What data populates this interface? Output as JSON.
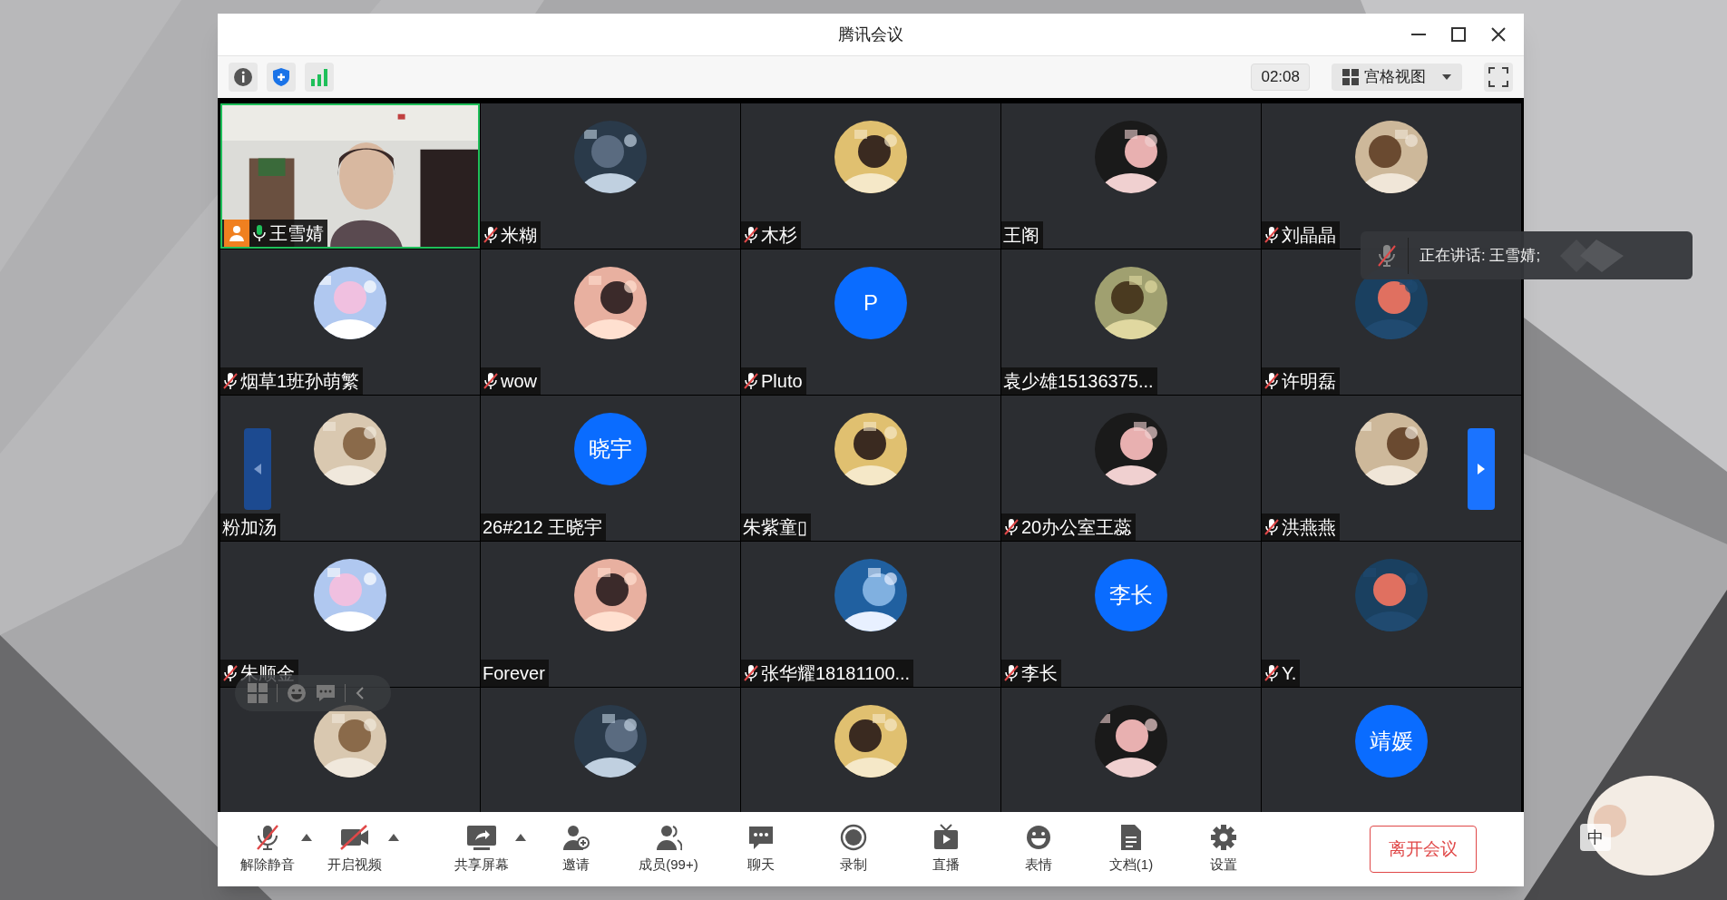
{
  "window": {
    "title": "腾讯会议"
  },
  "info_bar": {
    "timer": "02:08",
    "view_label": "宫格视图"
  },
  "tiles": [
    {
      "name": "王雪婧",
      "host": true,
      "muted": false,
      "talking": true,
      "avatar": {
        "kind": "video"
      }
    },
    {
      "name": "米糊",
      "muted": true,
      "avatar": {
        "kind": "picture"
      }
    },
    {
      "name": "木杉",
      "muted": true,
      "avatar": {
        "kind": "picture"
      }
    },
    {
      "name": "王阁",
      "muted": false,
      "avatar": {
        "kind": "picture"
      }
    },
    {
      "name": "刘晶晶",
      "muted": true,
      "avatar": {
        "kind": "picture"
      }
    },
    {
      "name": "烟草1班孙萌繁",
      "muted": true,
      "avatar": {
        "kind": "picture"
      }
    },
    {
      "name": "wow",
      "muted": true,
      "avatar": {
        "kind": "picture"
      }
    },
    {
      "name": "Pluto",
      "muted": true,
      "avatar": {
        "kind": "text",
        "text": "P"
      }
    },
    {
      "name": "袁少雄15136375...",
      "muted": false,
      "avatar": {
        "kind": "picture"
      }
    },
    {
      "name": "许明磊",
      "muted": true,
      "avatar": {
        "kind": "picture"
      }
    },
    {
      "name": "粉加汤",
      "muted": false,
      "avatar": {
        "kind": "picture"
      }
    },
    {
      "name": "26#212 王晓宇",
      "muted": false,
      "avatar": {
        "kind": "text",
        "text": "晓宇"
      }
    },
    {
      "name": "朱紫童▯",
      "muted": false,
      "avatar": {
        "kind": "picture"
      }
    },
    {
      "name": "20办公室王蕊",
      "muted": true,
      "avatar": {
        "kind": "picture"
      }
    },
    {
      "name": "洪燕燕",
      "muted": true,
      "avatar": {
        "kind": "picture"
      }
    },
    {
      "name": "朱顺金",
      "muted": true,
      "avatar": {
        "kind": "picture"
      }
    },
    {
      "name": "Forever",
      "muted": false,
      "avatar": {
        "kind": "picture"
      }
    },
    {
      "name": "张华耀18181100...",
      "muted": true,
      "avatar": {
        "kind": "picture"
      }
    },
    {
      "name": "李长",
      "muted": true,
      "avatar": {
        "kind": "text",
        "text": "李长"
      }
    },
    {
      "name": "Y.",
      "muted": true,
      "avatar": {
        "kind": "picture"
      }
    },
    {
      "avatar": {
        "kind": "picture"
      }
    },
    {
      "avatar": {
        "kind": "picture"
      }
    },
    {
      "avatar": {
        "kind": "picture"
      }
    },
    {
      "avatar": {
        "kind": "picture"
      }
    },
    {
      "avatar": {
        "kind": "text",
        "text": "靖媛"
      }
    }
  ],
  "paging": {
    "prev_enabled": false,
    "next_enabled": true
  },
  "speaking_toast": {
    "text": "正在讲话: 王雪婧;"
  },
  "toolbar": [
    {
      "kind": "mic",
      "label": "解除静音",
      "dropdown": true
    },
    {
      "kind": "video",
      "label": "开启视频",
      "dropdown": true
    },
    {
      "kind": "share",
      "label": "共享屏幕",
      "dropdown": true
    },
    {
      "kind": "invite",
      "label": "邀请"
    },
    {
      "kind": "members",
      "label": "成员(99+)"
    },
    {
      "kind": "chat",
      "label": "聊天"
    },
    {
      "kind": "record",
      "label": "录制"
    },
    {
      "kind": "live",
      "label": "直播"
    },
    {
      "kind": "emoji",
      "label": "表情"
    },
    {
      "kind": "doc",
      "label": "文档(1)"
    },
    {
      "kind": "settings",
      "label": "设置"
    }
  ],
  "leave_button": {
    "label": "离开会议"
  },
  "ime_indicator": {
    "text": "中"
  }
}
